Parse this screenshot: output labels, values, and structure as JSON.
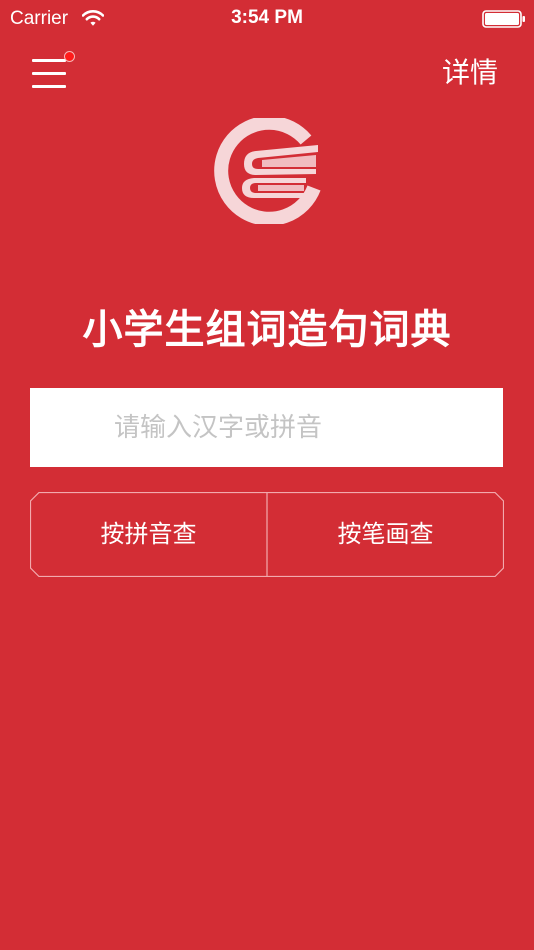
{
  "status_bar": {
    "carrier": "Carrier",
    "time": "3:54 PM"
  },
  "nav": {
    "details_label": "详情",
    "menu_has_notification": true
  },
  "main": {
    "title": "小学生组词造句词典",
    "search_placeholder": "请输入汉字或拼音",
    "search_value": "",
    "lookup_buttons": [
      {
        "label": "按拼音查"
      },
      {
        "label": "按笔画查"
      }
    ]
  },
  "icons": {
    "menu": "hamburger-menu-icon",
    "logo": "book-logo-icon",
    "wifi": "wifi-icon",
    "battery": "battery-icon"
  },
  "colors": {
    "background": "#d32d35",
    "accent_dot": "#ff1a1a",
    "logo_tint": "#f6d6d8",
    "placeholder": "#c4c4c4"
  }
}
